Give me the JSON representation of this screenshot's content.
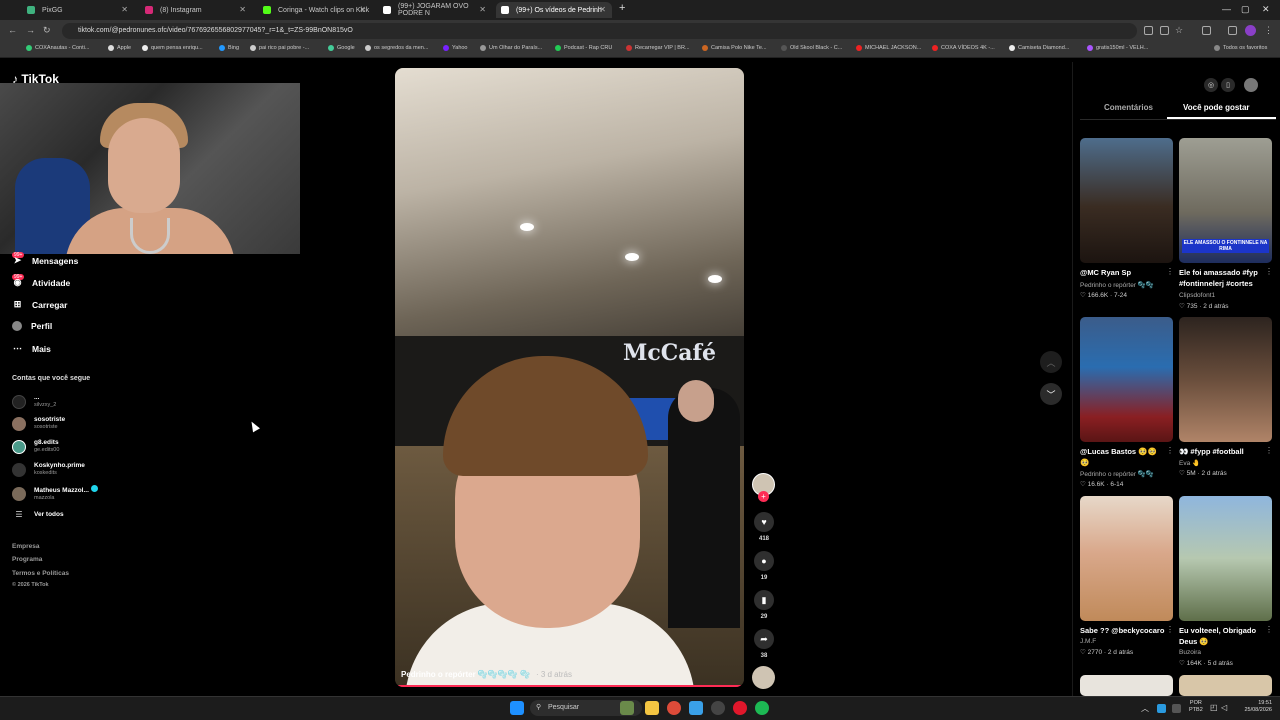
{
  "browser": {
    "tabs": [
      {
        "label": "PixGG",
        "color": "#3fb27f"
      },
      {
        "label": "(8) Instagram",
        "color": "#d62976"
      },
      {
        "label": "Coringa - Watch clips on Kick",
        "color": "#53fc18"
      },
      {
        "label": "(99+) JOGARAM OVO PODRE N",
        "color": "#ffffff"
      },
      {
        "label": "(99+) Os vídeos de Pedrinh",
        "color": "#ffffff",
        "active": true
      }
    ],
    "url": "tiktok.com/@pedronunes.ofc/video/7676926556802977045?_r=1&_t=ZS-99BnON815vO",
    "bookmarks": [
      "COXAnautas - Conti...",
      "Apple",
      "quem pensa enriqu...",
      "Bing",
      "pai rico pai pobre -...",
      "Google",
      "os segredos da men...",
      "Yahoo",
      "Um Olhar do Paraís...",
      "Podcast - Rap CRU",
      "Recarregar VIP | BR...",
      "Camisa Polo Nike Te...",
      "Old Skool Black - C...",
      "MICHAEL JACKSON...",
      "COXA VÍDEOS 4K -...",
      "Camiseta Diamond...",
      "gratis150ml - VELH...",
      "Todos os favoritos"
    ]
  },
  "tiktok": {
    "logo": "TikTok",
    "nav": [
      {
        "label": "Mensagens",
        "icon": "paper-plane-icon",
        "badge": "99+"
      },
      {
        "label": "Atividade",
        "icon": "activity-icon",
        "badge": "99+"
      },
      {
        "label": "Carregar",
        "icon": "upload-icon"
      },
      {
        "label": "Perfil",
        "icon": "profile-icon"
      },
      {
        "label": "Mais",
        "icon": "more-icon"
      }
    ],
    "following_title": "Contas que você segue",
    "following": [
      {
        "name": "...",
        "user": "silvzxy_2"
      },
      {
        "name": "sosotriste",
        "user": "sosotriste"
      },
      {
        "name": "g8.edits",
        "user": "ge.edits00"
      },
      {
        "name": "Koskynho.prime",
        "user": "koskedits"
      },
      {
        "name": "Matheus Mazzol...",
        "user": "mazzola",
        "verified": true
      }
    ],
    "see_all": "Ver todos",
    "footer": [
      "Empresa",
      "Programa",
      "Termos e Políticas",
      "© 2026 TikTok"
    ],
    "video": {
      "sign": "McCafé",
      "caption": "Pedrinho o repórter 🫧🫧🫧🫧 🫧",
      "time": "· 3 d atrás",
      "likes": "418",
      "comments": "19",
      "saves": "29",
      "shares": "38"
    },
    "right_panel": {
      "tab_comments": "Comentários",
      "tab_suggested": "Você pode gostar",
      "cards": [
        {
          "title": "@MC Ryan Sp",
          "author": "Pedrinho o repórter 🫧🫧",
          "stats": "♡ 166.6K · 7-24"
        },
        {
          "title": "Ele foi amassado #fyp #fontinnelerj #cortes",
          "author": "Clipsdofont1",
          "stats": "♡ 735 · 2 d atrás",
          "overlay": "ELE AMASSOU O FONTINNELE NA RIMA"
        },
        {
          "title": "@Lucas Bastos 🥺🥺 🥺",
          "author": "Pedrinho o repórter 🫧🫧",
          "stats": "♡ 16.6K · 6-14"
        },
        {
          "title": "👀 #fypp #football",
          "author": "Eva 🤚",
          "stats": "♡ 5M · 2 d atrás"
        },
        {
          "title": "Sabe ?? @beckycocaro",
          "author": "J.M.F",
          "stats": "♡ 2770 · 2 d atrás"
        },
        {
          "title": "Eu volteeel, Obrigado Deus 🥺",
          "author": "Buzoira",
          "stats": "♡ 164K · 5 d atrás"
        }
      ]
    }
  },
  "taskbar": {
    "search": "Pesquisar",
    "lang": "POR",
    "lang2": "PTB2",
    "time": "19:51",
    "date": "25/08/2026"
  }
}
